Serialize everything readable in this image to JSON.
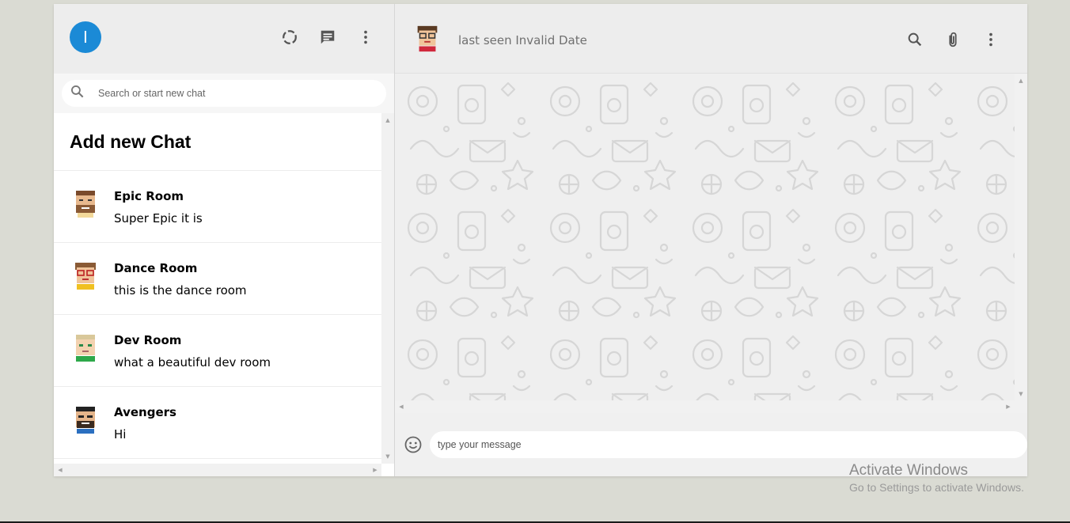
{
  "sidebar": {
    "user_initial": "I",
    "search_placeholder": "Search or start new chat",
    "add_chat_label": "Add new Chat",
    "chats": [
      {
        "name": "Epic Room",
        "last_message": "Super Epic it is"
      },
      {
        "name": "Dance Room",
        "last_message": "this is the dance room"
      },
      {
        "name": "Dev Room",
        "last_message": "what a beautiful dev room"
      },
      {
        "name": "Avengers",
        "last_message": "Hi"
      }
    ],
    "icons": [
      "status-icon",
      "new-chat-icon",
      "more-options-icon"
    ]
  },
  "chat": {
    "last_seen": "last seen Invalid Date",
    "icons": [
      "search-icon",
      "attach-icon",
      "more-options-icon"
    ],
    "message_placeholder": "type your message"
  },
  "watermark": {
    "title": "Activate Windows",
    "subtitle": "Go to Settings to activate Windows."
  },
  "colors": {
    "avatar": "#1b8ad6",
    "header_bg": "#ededed",
    "page_bg": "#dadbd3"
  }
}
